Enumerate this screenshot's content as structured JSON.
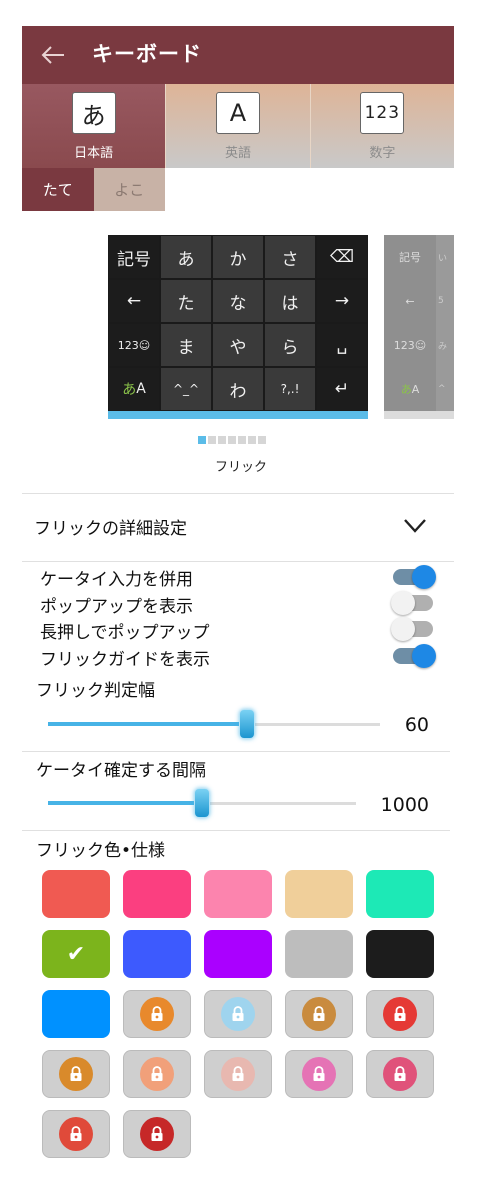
{
  "header": {
    "title": "キーボード"
  },
  "layout_tabs": [
    {
      "glyph": "あ",
      "label": "日本語",
      "active": true
    },
    {
      "glyph": "A",
      "label": "英語",
      "active": false
    },
    {
      "glyph": "123",
      "label": "数字",
      "active": false
    }
  ],
  "orientation_tabs": [
    {
      "label": "たて",
      "active": true
    },
    {
      "label": "よこ",
      "active": false
    }
  ],
  "keyboard_preview": {
    "rows": [
      [
        "記号",
        "あ",
        "か",
        "さ",
        "⌫"
      ],
      [
        "←",
        "た",
        "な",
        "は",
        "→"
      ],
      [
        "123☺",
        "ま",
        "や",
        "ら",
        "␣"
      ],
      [
        "あA",
        "^_^",
        "わ",
        "?,.!",
        "↵"
      ]
    ],
    "second_preview": {
      "col1": [
        "記号",
        "←",
        "123☺",
        "あA"
      ],
      "col2": [
        "い",
        "5",
        "み",
        "^"
      ]
    }
  },
  "pager": {
    "count": 7,
    "current": 1
  },
  "layout_name": "フリック",
  "section": {
    "title": "フリックの詳細設定"
  },
  "options": [
    {
      "label": "ケータイ入力を併用",
      "on": true
    },
    {
      "label": "ポップアップを表示",
      "on": false
    },
    {
      "label": "長押しでポップアップ",
      "on": false
    },
    {
      "label": "フリックガイドを表示",
      "on": true
    }
  ],
  "sliders": [
    {
      "label": "フリック判定幅",
      "value": "60",
      "fraction": 0.6
    },
    {
      "label": "ケータイ確定する間隔",
      "value": "1000",
      "fraction": 0.5
    }
  ],
  "colors_section": {
    "title": "フリック色•仕様"
  },
  "swatches": [
    {
      "name": "red",
      "color": "#f05a52"
    },
    {
      "name": "pink",
      "color": "#fb3f80"
    },
    {
      "name": "light-pink",
      "color": "#fc84ae"
    },
    {
      "name": "beige",
      "color": "#f0cf9a"
    },
    {
      "name": "teal",
      "color": "#1de9b6"
    },
    {
      "name": "green",
      "color": "#7cb41c",
      "selected": true
    },
    {
      "name": "blue",
      "color": "#3d5afe"
    },
    {
      "name": "purple",
      "color": "#aa00ff"
    },
    {
      "name": "gray",
      "color": "#bdbdbd"
    },
    {
      "name": "black",
      "color": "#1c1c1c"
    },
    {
      "name": "sky-blue",
      "color": "#0091ff"
    },
    {
      "name": "pumpkin",
      "icon": "pumpkin-icon",
      "tint": "#e8892c",
      "locked": true
    },
    {
      "name": "bird",
      "icon": "bird-icon",
      "tint": "#9fd4ee",
      "locked": true
    },
    {
      "name": "pudding",
      "icon": "pudding-icon",
      "tint": "#c98b3e",
      "locked": true
    },
    {
      "name": "strawberry",
      "icon": "strawberry-icon",
      "tint": "#e53935",
      "locked": true
    },
    {
      "name": "juice",
      "icon": "juice-bottle-icon",
      "tint": "#d98a2b",
      "locked": true
    },
    {
      "name": "paw",
      "icon": "paw-icon",
      "tint": "#f1a07a",
      "locked": true
    },
    {
      "name": "cat-paw",
      "icon": "cat-paw-icon",
      "tint": "#e8b8b0",
      "locked": true
    },
    {
      "name": "candy",
      "icon": "candy-icon",
      "tint": "#e573b5",
      "locked": true
    },
    {
      "name": "heart",
      "icon": "heart-icon",
      "tint": "#e0527a",
      "locked": true
    },
    {
      "name": "watermelon",
      "icon": "watermelon-icon",
      "tint": "#e04a3a",
      "locked": true
    },
    {
      "name": "meat",
      "icon": "meat-icon",
      "tint": "#c62828",
      "locked": true
    }
  ]
}
